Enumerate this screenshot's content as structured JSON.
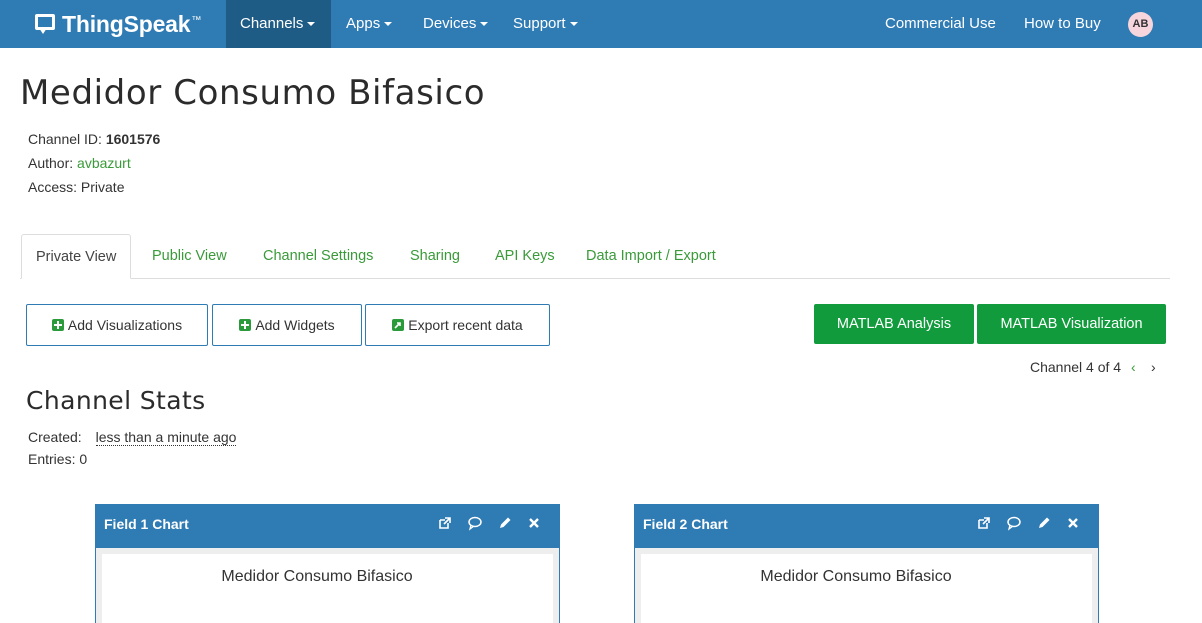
{
  "navbar": {
    "brand": "ThingSpeak",
    "brand_tm": "™",
    "items": [
      {
        "label": "Channels"
      },
      {
        "label": "Apps"
      },
      {
        "label": "Devices"
      },
      {
        "label": "Support"
      }
    ],
    "commercial_use": "Commercial Use",
    "how_to_buy": "How to Buy",
    "avatar_initials": "AB"
  },
  "channel": {
    "title": "Medidor Consumo Bifasico",
    "id_label": "Channel ID: ",
    "id_value": "1601576",
    "author_label": "Author: ",
    "author_value": "avbazurt",
    "access_label": "Access: ",
    "access_value": "Private"
  },
  "tabs": [
    {
      "label": "Private View"
    },
    {
      "label": "Public View"
    },
    {
      "label": "Channel Settings"
    },
    {
      "label": "Sharing"
    },
    {
      "label": "API Keys"
    },
    {
      "label": "Data Import / Export"
    }
  ],
  "actions": {
    "add_visualizations": "Add Visualizations",
    "add_widgets": "Add Widgets",
    "export_recent_data": "Export recent data",
    "matlab_analysis": "MATLAB Analysis",
    "matlab_visualization": "MATLAB Visualization"
  },
  "channel_nav": {
    "label": "Channel 4 of 4",
    "prev": "‹",
    "next": "›"
  },
  "stats": {
    "title": "Channel Stats",
    "created_label": "Created:",
    "created_value": "less than a minute ago",
    "entries_label": "Entries: ",
    "entries_value": "0"
  },
  "charts": [
    {
      "header": "Field 1 Chart",
      "title": "Medidor Consumo Bifasico"
    },
    {
      "header": "Field 2 Chart",
      "title": "Medidor Consumo Bifasico"
    }
  ],
  "colors": {
    "navbar": "#2f7bb4",
    "navbar_active": "#1f5c85",
    "accent_green": "#119b3d",
    "link_green": "#3a9a3a"
  },
  "icons": [
    "chat-bubble-logo-icon",
    "plus-square-icon",
    "export-arrow-icon",
    "external-link-icon",
    "comment-icon",
    "pencil-icon",
    "close-icon",
    "chevron-left-icon",
    "chevron-right-icon",
    "caret-down-icon"
  ]
}
